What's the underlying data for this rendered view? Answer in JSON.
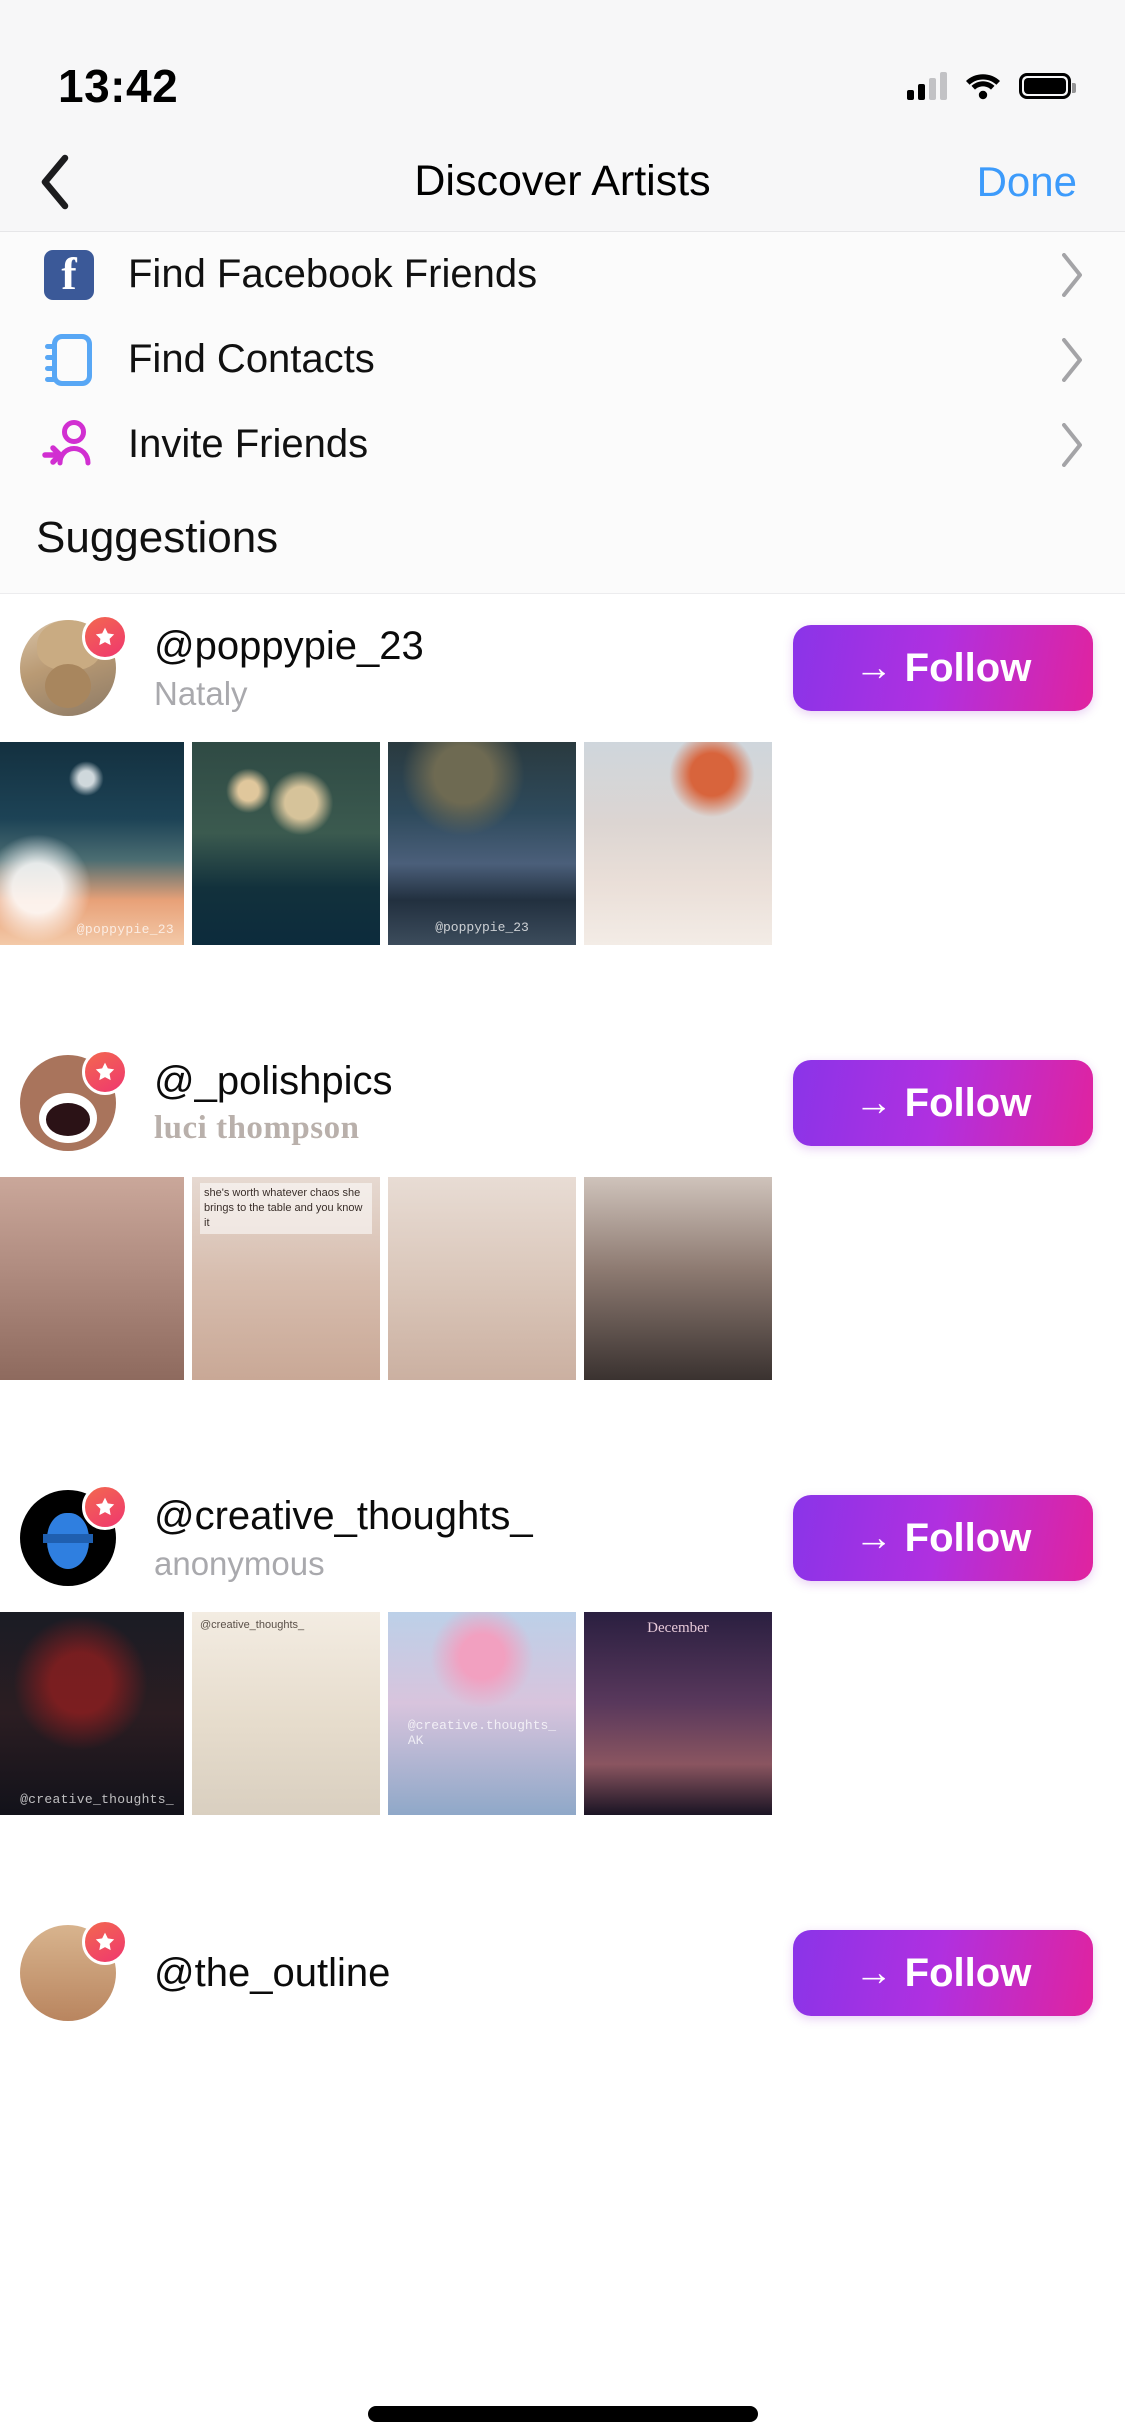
{
  "status_bar": {
    "time": "13:42",
    "signal_icon": "cellular-signal-icon",
    "wifi_icon": "wifi-icon",
    "battery_icon": "battery-icon"
  },
  "nav": {
    "back_icon": "chevron-left-icon",
    "title": "Discover Artists",
    "done_label": "Done"
  },
  "actions": [
    {
      "label": "Find Facebook Friends",
      "icon": "facebook-icon",
      "chevron": "chevron-right-icon"
    },
    {
      "label": "Find Contacts",
      "icon": "contacts-book-icon",
      "chevron": "chevron-right-icon"
    },
    {
      "label": "Invite Friends",
      "icon": "person-add-icon",
      "chevron": "chevron-right-icon"
    }
  ],
  "suggestions": {
    "header": "Suggestions",
    "follow_label": "Follow",
    "follow_arrow": "→",
    "badge_icon": "star-badge-icon",
    "artists": [
      {
        "username": "@poppypie_23",
        "display_name": "Nataly",
        "follow_label": "Follow",
        "thumbs": [
          {
            "watermark": "@poppypie_23"
          },
          {
            "watermark": ""
          },
          {
            "watermark": "@poppypie_23"
          },
          {
            "watermark": ""
          }
        ]
      },
      {
        "username": "@_polishpics",
        "display_name": "luci thompson",
        "follow_label": "Follow",
        "thumbs": [
          {
            "watermark": ""
          },
          {
            "watermark": "she's worth whatever chaos she brings to the table and you know it"
          },
          {
            "watermark": ""
          },
          {
            "watermark": ""
          }
        ]
      },
      {
        "username": "@creative_thoughts_",
        "display_name": "anonymous",
        "follow_label": "Follow",
        "thumbs": [
          {
            "watermark": "@creative_thoughts_"
          },
          {
            "watermark": "@creative_thoughts_"
          },
          {
            "watermark": "@creative.thoughts_ AK"
          },
          {
            "watermark": "December"
          }
        ]
      },
      {
        "username": "@the_outline",
        "display_name": "",
        "follow_label": "Follow",
        "thumbs": []
      }
    ]
  },
  "colors": {
    "accent_blue": "#3d9bfb",
    "facebook_blue": "#3b5998",
    "contacts_blue": "#58a7f5",
    "invite_pink": "#d12fd1",
    "follow_gradient_start": "#8a34e8",
    "follow_gradient_end": "#e0239f",
    "badge_gradient_start": "#f2684f",
    "badge_gradient_end": "#f0376f",
    "page_bg": "#ffffff",
    "chrome_bg": "#f7f7f8"
  },
  "home_indicator": "home-indicator"
}
